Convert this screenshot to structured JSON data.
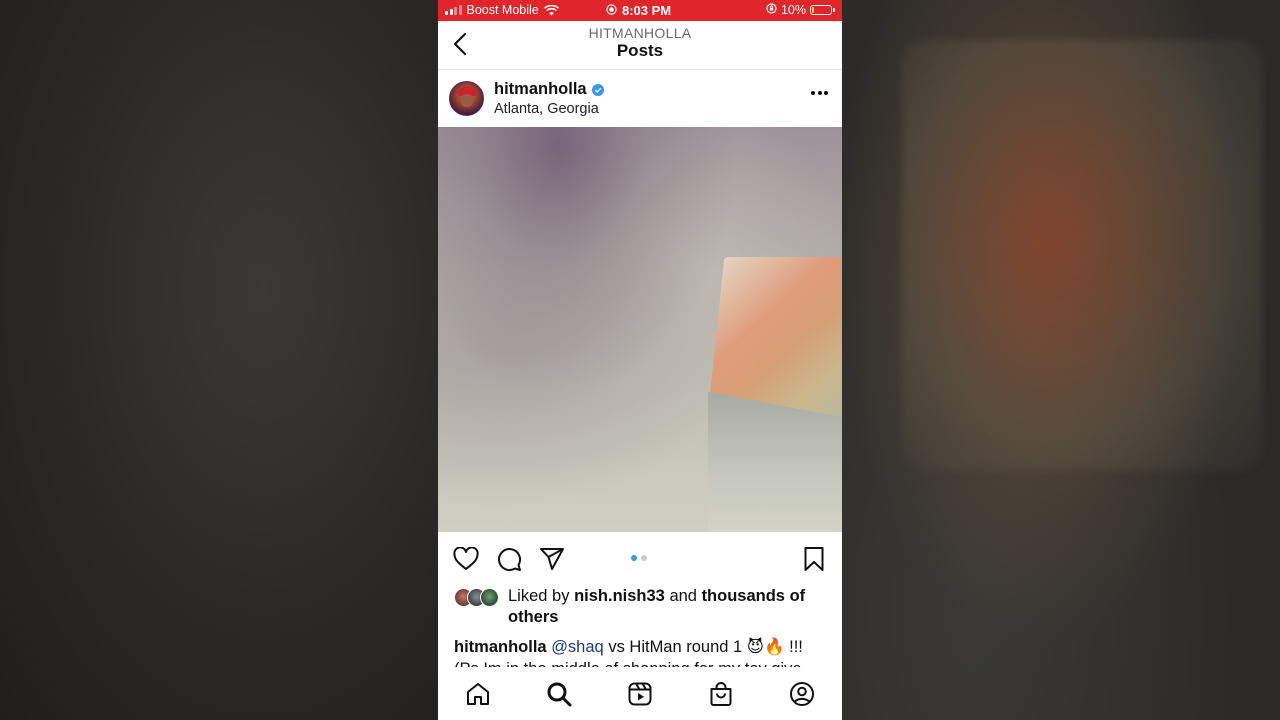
{
  "status_bar": {
    "carrier": "Boost Mobile",
    "time": "8:03 PM",
    "battery_percent": "10%",
    "battery_level": 0.1,
    "bar_color": "#e0262b"
  },
  "header": {
    "account": "HITMANHOLLA",
    "title": "Posts"
  },
  "post": {
    "username": "hitmanholla",
    "verified": true,
    "location": "Atlanta, Georgia",
    "carousel": {
      "count": 2,
      "active_index": 0
    },
    "likes": {
      "prefix": "Liked by",
      "liker": "nish.nish33",
      "middle": "and",
      "others": "thousands of others"
    },
    "caption": {
      "user": "hitmanholla",
      "mention": "@shaq",
      "text": "vs HitMan round 1 😈🔥 !!!",
      "line2": "(Ps Im in the middle of shopping for my toy give"
    }
  },
  "icons": {
    "back": "chevron-left-icon",
    "more": "more-horizontal-icon",
    "like": "heart-icon",
    "comment": "comment-icon",
    "share": "send-icon",
    "save": "bookmark-icon",
    "tabs": [
      "home-icon",
      "search-icon",
      "reels-icon",
      "shop-icon",
      "profile-icon"
    ]
  },
  "colors": {
    "accent": "#3897f0",
    "mention": "#1e3a78"
  }
}
